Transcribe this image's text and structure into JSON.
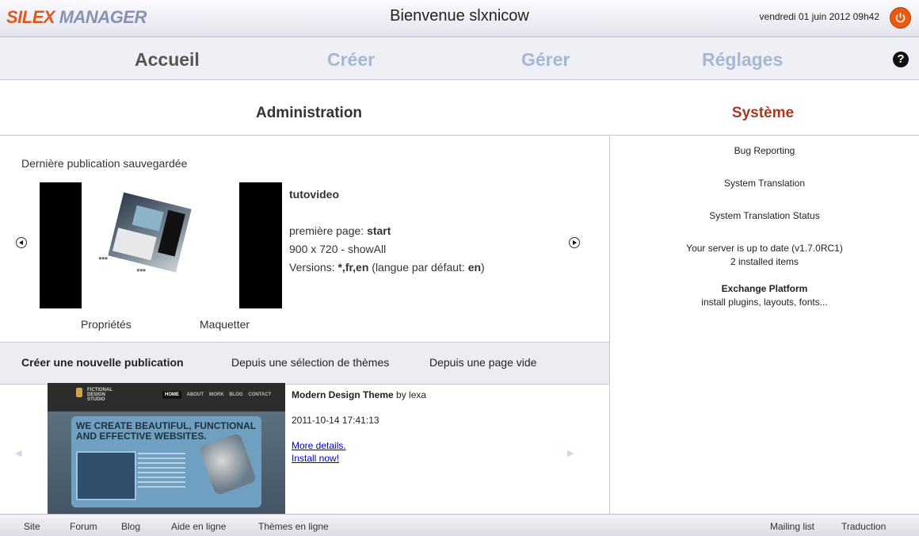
{
  "header": {
    "logo_part1": "SILEX",
    "logo_part2": "MANAGER",
    "welcome": "Bienvenue slxnicow",
    "date": "vendredi 01 juin 2012 09h42",
    "power_icon": "power-icon"
  },
  "nav": {
    "items": [
      {
        "label": "Accueil",
        "active": true
      },
      {
        "label": "Créer",
        "active": false
      },
      {
        "label": "Gérer",
        "active": false
      },
      {
        "label": "Réglages",
        "active": false
      }
    ],
    "help": "?"
  },
  "admin": {
    "title": "Administration",
    "last_pub_label": "Dernière publication sauvegardée",
    "pub_name": "tutovideo",
    "first_page_label": "première page: ",
    "first_page_value": "start",
    "size": "900 x 720 - showAll",
    "versions_label": "Versions: ",
    "versions_value": "*,fr,en",
    "default_lang_label": " (langue par défaut: ",
    "default_lang_value": "en",
    "default_lang_close": ")",
    "properties": "Propriétés",
    "layout": "Maquetter"
  },
  "system": {
    "title": "Système",
    "title_color": "#a83a25",
    "bug": "Bug Reporting",
    "translation": "System Translation",
    "translation_status": "System Translation Status",
    "server_status": "Your server is up to date (v1.7.0RC1)",
    "installed": "2 installed items",
    "exchange_title": "Exchange Platform",
    "exchange_sub": "install plugins, layouts, fonts..."
  },
  "create": {
    "label": "Créer une nouvelle publication",
    "from_themes": "Depuis une sélection de thèmes",
    "from_blank": "Depuis une page vide"
  },
  "theme": {
    "name": "Modern Design Theme",
    "by": " by lexa",
    "date": "2011-10-14 17:41:13",
    "more": "More details.",
    "install": "Install now!",
    "img_logo_1": "FICTIONAL",
    "img_logo_2": "DESIGN",
    "img_logo_3": "STUDIO",
    "img_nav": [
      "HOME",
      "ABOUT",
      "WORK",
      "BLOG",
      "CONTACT"
    ],
    "img_headline_1": "WE CREATE BEAUTIFUL, FUNCTIONAL",
    "img_headline_2": "AND EFFECTIVE WEBSITES."
  },
  "footer": {
    "left": [
      "Site",
      "Forum",
      "Blog",
      "Aide en ligne",
      "Thèmes en ligne"
    ],
    "right": [
      "Mailing list",
      "Traduction"
    ]
  }
}
